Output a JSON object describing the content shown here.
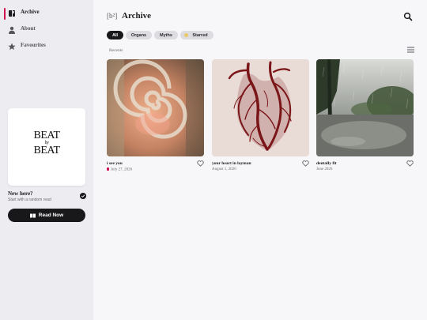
{
  "sidebar": {
    "items": [
      {
        "label": "Archive",
        "icon": "book-icon",
        "active": true
      },
      {
        "label": "About",
        "icon": "person-icon",
        "active": false
      },
      {
        "label": "Favourites",
        "icon": "star-icon",
        "active": false
      }
    ],
    "feature": {
      "logo_top": "BEAT",
      "logo_by": "by",
      "logo_bottom": "BEAT",
      "heading": "New here?",
      "subtext": "Start with a random read",
      "button_label": "Read Now"
    }
  },
  "header": {
    "brand": "[b²]",
    "title": "Archive",
    "search_icon": "search-icon"
  },
  "filters": {
    "chips": [
      {
        "label": "All",
        "active": true
      },
      {
        "label": "Organs",
        "active": false
      },
      {
        "label": "Myths",
        "active": false
      },
      {
        "label": "Starred",
        "active": false
      }
    ]
  },
  "section": {
    "label": "Recents",
    "view_icon": "list-view-icon"
  },
  "cards": [
    {
      "title": "i see you",
      "date": "July 27, 2026",
      "pinned": true
    },
    {
      "title": "your heart in layman",
      "date": "August 1, 2026",
      "pinned": false
    },
    {
      "title": "dentally fit",
      "date": "June 2026",
      "pinned": false
    }
  ],
  "colors": {
    "accent": "#d1114f",
    "dark": "#18181a",
    "sidebar_bg": "#ececf1",
    "page_bg": "#f7f7f9",
    "chip_bg": "#dcdce1",
    "starred_dot": "#e8c96a"
  }
}
